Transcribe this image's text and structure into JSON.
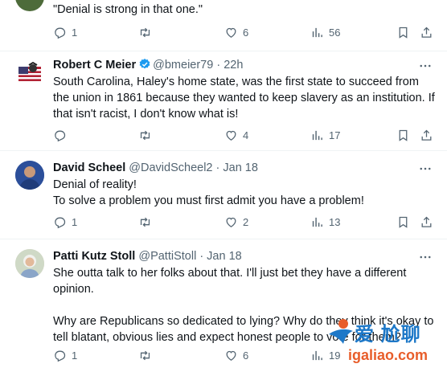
{
  "tweets": [
    {
      "body": "\"Denial is strong in that one.\"",
      "reply_count": "1",
      "retweet_count": "",
      "like_count": "6",
      "view_count": "56"
    },
    {
      "name": "Robert C Meier",
      "handle": "@bmeier79",
      "time": "· 22h",
      "verified": true,
      "body": "South Carolina, Haley's home state, was the first state to succeed from the union in 1861 because they wanted to keep slavery as an institution. If that isn't racist, I don't know what is!",
      "reply_count": "",
      "retweet_count": "",
      "like_count": "4",
      "view_count": "17"
    },
    {
      "name": "David Scheel",
      "handle": "@DavidScheel2",
      "time": "· Jan 18",
      "body": "Denial of reality!\nTo solve a problem you must first admit you have a problem!",
      "reply_count": "1",
      "retweet_count": "",
      "like_count": "2",
      "view_count": "13"
    },
    {
      "name": "Patti Kutz Stoll",
      "handle": "@PattiStoll",
      "time": "· Jan 18",
      "body": "She outta talk to her folks about that. I'll just bet they have a different opinion.\n\nWhy are Republicans so dedicated to lying? Why do they think it's okay to tell blatant, obvious lies and expect honest people to vote for them?",
      "reply_count": "1",
      "retweet_count": "",
      "like_count": "6",
      "view_count": "19"
    }
  ],
  "watermark": {
    "top_text": "爱 尬聊",
    "url_text": "igaliao.com"
  },
  "colors": {
    "text": "#0f1419",
    "secondary": "#536471",
    "divider": "#eff3f4",
    "verified_blue": "#1d9bf0"
  },
  "icons": [
    "reply-icon",
    "retweet-icon",
    "like-icon",
    "views-icon",
    "bookmark-icon",
    "share-icon",
    "more-icon",
    "verified-icon"
  ]
}
